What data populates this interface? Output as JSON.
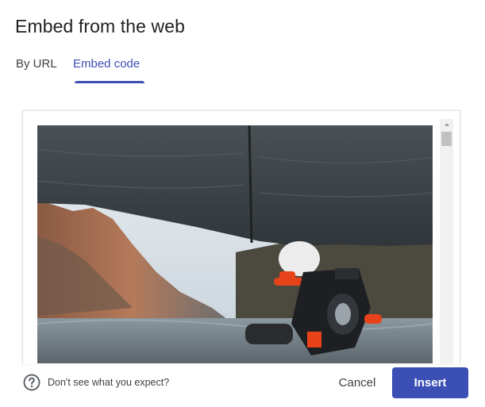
{
  "dialog": {
    "title": "Embed from the web"
  },
  "tabs": [
    {
      "label": "By URL",
      "active": false
    },
    {
      "label": "Embed code",
      "active": true
    }
  ],
  "preview": {
    "image": "motorcycle-under-tarp-by-lake-photo"
  },
  "footer": {
    "help_icon": "help-circle-icon",
    "help_text": "Don't see what you expect?",
    "cancel_label": "Cancel",
    "insert_label": "Insert"
  },
  "colors": {
    "accent": "#3c4fb5",
    "text_primary": "#202124",
    "text_secondary": "#3c4043"
  }
}
